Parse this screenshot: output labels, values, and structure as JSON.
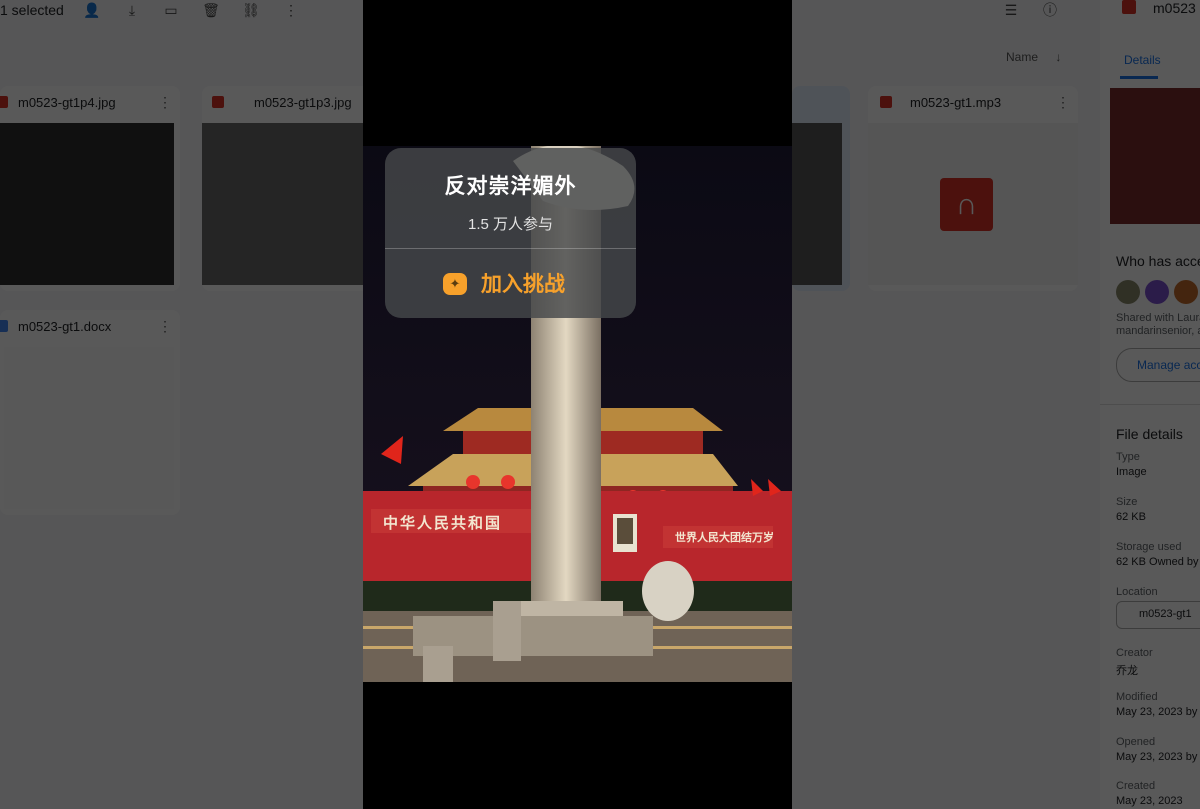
{
  "topbar": {
    "selected": "1 selected",
    "icons": [
      "add-person-icon",
      "download-icon",
      "move-folder-icon",
      "trash-icon",
      "link-icon",
      "more-vert-icon",
      "list-view-icon",
      "info-icon"
    ]
  },
  "sort": {
    "label": "Name",
    "arrow": "↓"
  },
  "files": [
    {
      "name": "m0523-gt1p4.jpg",
      "type": "image"
    },
    {
      "name": "m0523-gt1p3.jpg",
      "type": "image"
    },
    {
      "name": "m0523-gt1.mp3",
      "type": "audio"
    },
    {
      "name": "m0523-gt1.docx",
      "type": "doc"
    }
  ],
  "side_panel": {
    "file_title": "m0523",
    "tab": "Details",
    "who_has_access": "Who has acce",
    "shared_with": "Shared with Laura",
    "shared_with_2": "mandarinsenior, ar",
    "manage_access": "Manage acce",
    "file_details": "File details",
    "type_label": "Type",
    "type_value": "Image",
    "size_label": "Size",
    "size_value": "62 KB",
    "storage_label": "Storage used",
    "storage_value": "62 KB Owned by",
    "location_label": "Location",
    "location_value": "m0523-gt1",
    "creator_label": "Creator",
    "creator_value": "乔龙",
    "modified_label": "Modified",
    "modified_value": "May 23, 2023 by",
    "opened_label": "Opened",
    "opened_value": "May 23, 2023 by",
    "created_label": "Created",
    "created_value": "May 23, 2023"
  },
  "popup": {
    "title": "反对崇洋媚外",
    "participants": "1.5 万人参与",
    "join_label": "加入挑战"
  },
  "photo": {
    "banner_left": "中华人民共和国",
    "banner_right": "世界人民大团结万岁"
  },
  "colors": {
    "accent_orange": "#f7a12b",
    "wall_red": "#b8262c",
    "roof_gold": "#c8a25a"
  }
}
